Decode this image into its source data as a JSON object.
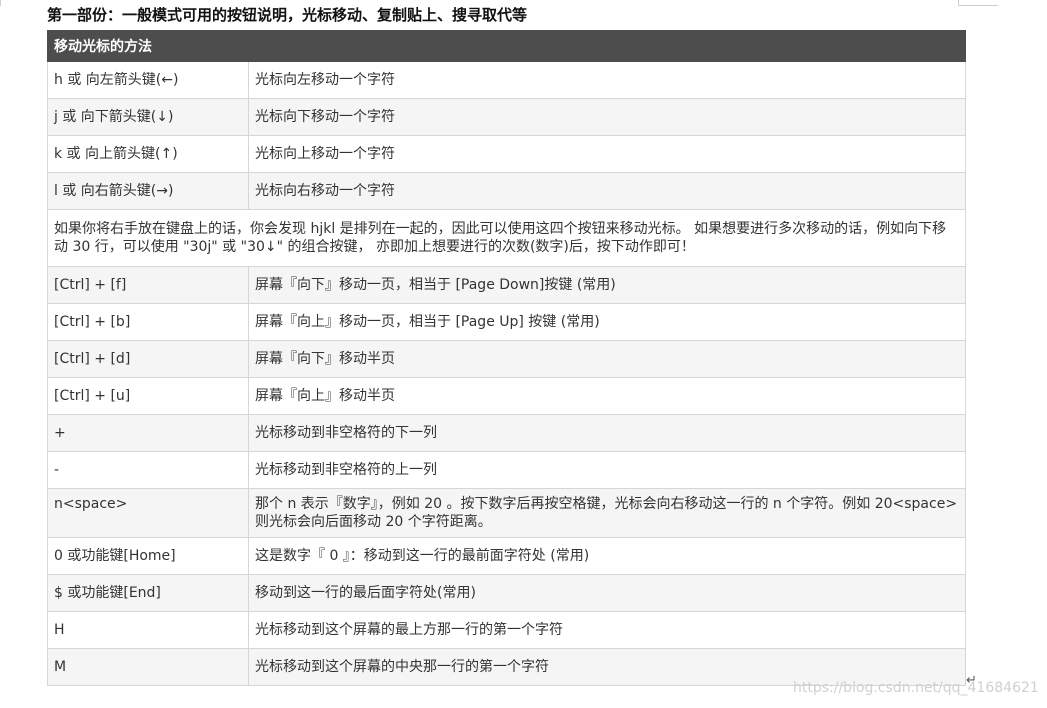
{
  "heading": "第一部份：一般模式可用的按钮说明，光标移动、复制贴上、搜寻取代等",
  "table": {
    "header": "移动光标的方法",
    "rows_a": [
      {
        "key": "h 或 向左箭头键(←)",
        "desc": "光标向左移动一个字符"
      },
      {
        "key": "j 或 向下箭头键(↓)",
        "desc": "光标向下移动一个字符"
      },
      {
        "key": "k 或 向上箭头键(↑)",
        "desc": "光标向上移动一个字符"
      },
      {
        "key": "l 或 向右箭头键(→)",
        "desc": "光标向右移动一个字符"
      }
    ],
    "note": "如果你将右手放在键盘上的话，你会发现 hjkl 是排列在一起的，因此可以使用这四个按钮来移动光标。 如果想要进行多次移动的话，例如向下移动 30 行，可以使用 \"30j\" 或 \"30↓\" 的组合按键， 亦即加上想要进行的次数(数字)后，按下动作即可！",
    "rows_b": [
      {
        "key": "[Ctrl] + [f]",
        "desc": "屏幕『向下』移动一页，相当于 [Page Down]按键 (常用)"
      },
      {
        "key": "[Ctrl] + [b]",
        "desc": "屏幕『向上』移动一页，相当于 [Page Up] 按键 (常用)"
      },
      {
        "key": "[Ctrl] + [d]",
        "desc": "屏幕『向下』移动半页"
      },
      {
        "key": "[Ctrl] + [u]",
        "desc": "屏幕『向上』移动半页"
      },
      {
        "key": "+",
        "desc": "光标移动到非空格符的下一列"
      },
      {
        "key": "-",
        "desc": "光标移动到非空格符的上一列"
      },
      {
        "key": "n<space>",
        "desc": "那个 n 表示『数字』，例如 20 。按下数字后再按空格键，光标会向右移动这一行的 n 个字符。例如 20<space> 则光标会向后面移动 20 个字符距离。"
      },
      {
        "key": "0 或功能键[Home]",
        "desc": "这是数字『 0 』：移动到这一行的最前面字符处 (常用)"
      },
      {
        "key": "$ 或功能键[End]",
        "desc": "移动到这一行的最后面字符处(常用)"
      },
      {
        "key": "H",
        "desc": "光标移动到这个屏幕的最上方那一行的第一个字符"
      },
      {
        "key": "M",
        "desc": "光标移动到这个屏幕的中央那一行的第一个字符"
      }
    ]
  },
  "return_mark": "↵",
  "watermark": "https://blog.csdn.net/qq_41684621"
}
